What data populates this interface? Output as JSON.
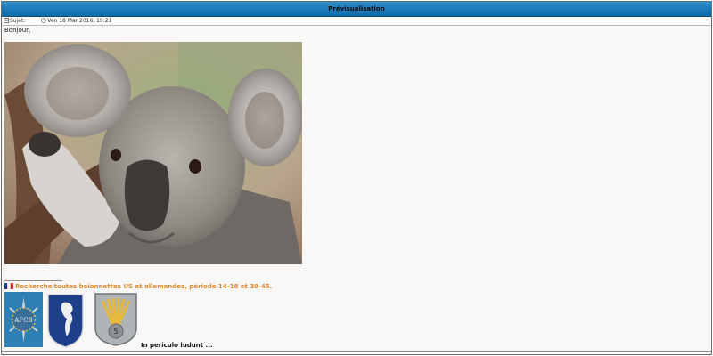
{
  "window": {
    "title": "Prévisualisation"
  },
  "post_meta": {
    "subject_label": "Sujet:",
    "subject_value": "",
    "date": "Ven 18 Mar 2016, 19:21"
  },
  "post": {
    "greeting": "Bonjour,"
  },
  "signature": {
    "text": "Recherche toutes baïonnettes US et allemandes, période 14-18 et 39-45.",
    "badges": [
      "AFCB",
      "5"
    ],
    "motto": "In periculo ludunt ..."
  },
  "icons": [
    "post-icon",
    "clock-icon",
    "france-flag-icon"
  ],
  "colors": {
    "title_bar": "#1f7cbe",
    "signature_text": "#e0892a",
    "background": "#faf8f7"
  }
}
